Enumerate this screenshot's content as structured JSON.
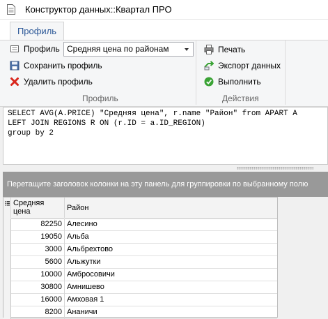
{
  "window": {
    "title": "Конструктор данных::Квартал ПРО"
  },
  "ribbon": {
    "tab": "Профиль",
    "profile_label": "Профиль",
    "profile_value": "Средняя цена по районам",
    "save_label": "Сохранить профиль",
    "delete_label": "Удалить профиль",
    "print_label": "Печать",
    "export_label": "Экспорт данных",
    "run_label": "Выполнить",
    "group_profile": "Профиль",
    "group_actions": "Действия"
  },
  "sql": {
    "lines": [
      "SELECT AVG(A.PRICE) \"Средняя цена\", r.name \"Район\" from APART A",
      "LEFT JOIN REGIONS R ON (r.ID = a.ID_REGION)",
      "group by 2"
    ]
  },
  "grid": {
    "group_hint": "Перетащите заголовок колонки на эту панель для группировки по выбранному полю",
    "col_price": "Средняя цена",
    "col_region": "Район",
    "rows": [
      {
        "price": "82250",
        "region": "Алесино"
      },
      {
        "price": "19050",
        "region": "Альба"
      },
      {
        "price": "3000",
        "region": "Альбрехтово"
      },
      {
        "price": "5600",
        "region": "Альжутки"
      },
      {
        "price": "10000",
        "region": "Амбросовичи"
      },
      {
        "price": "30800",
        "region": "Амнишево"
      },
      {
        "price": "16000",
        "region": "Амховая 1"
      },
      {
        "price": "8200",
        "region": "Ананичи"
      }
    ]
  },
  "colors": {
    "accent": "#2b5797",
    "delete": "#d9261c",
    "run": "#3aa335"
  }
}
